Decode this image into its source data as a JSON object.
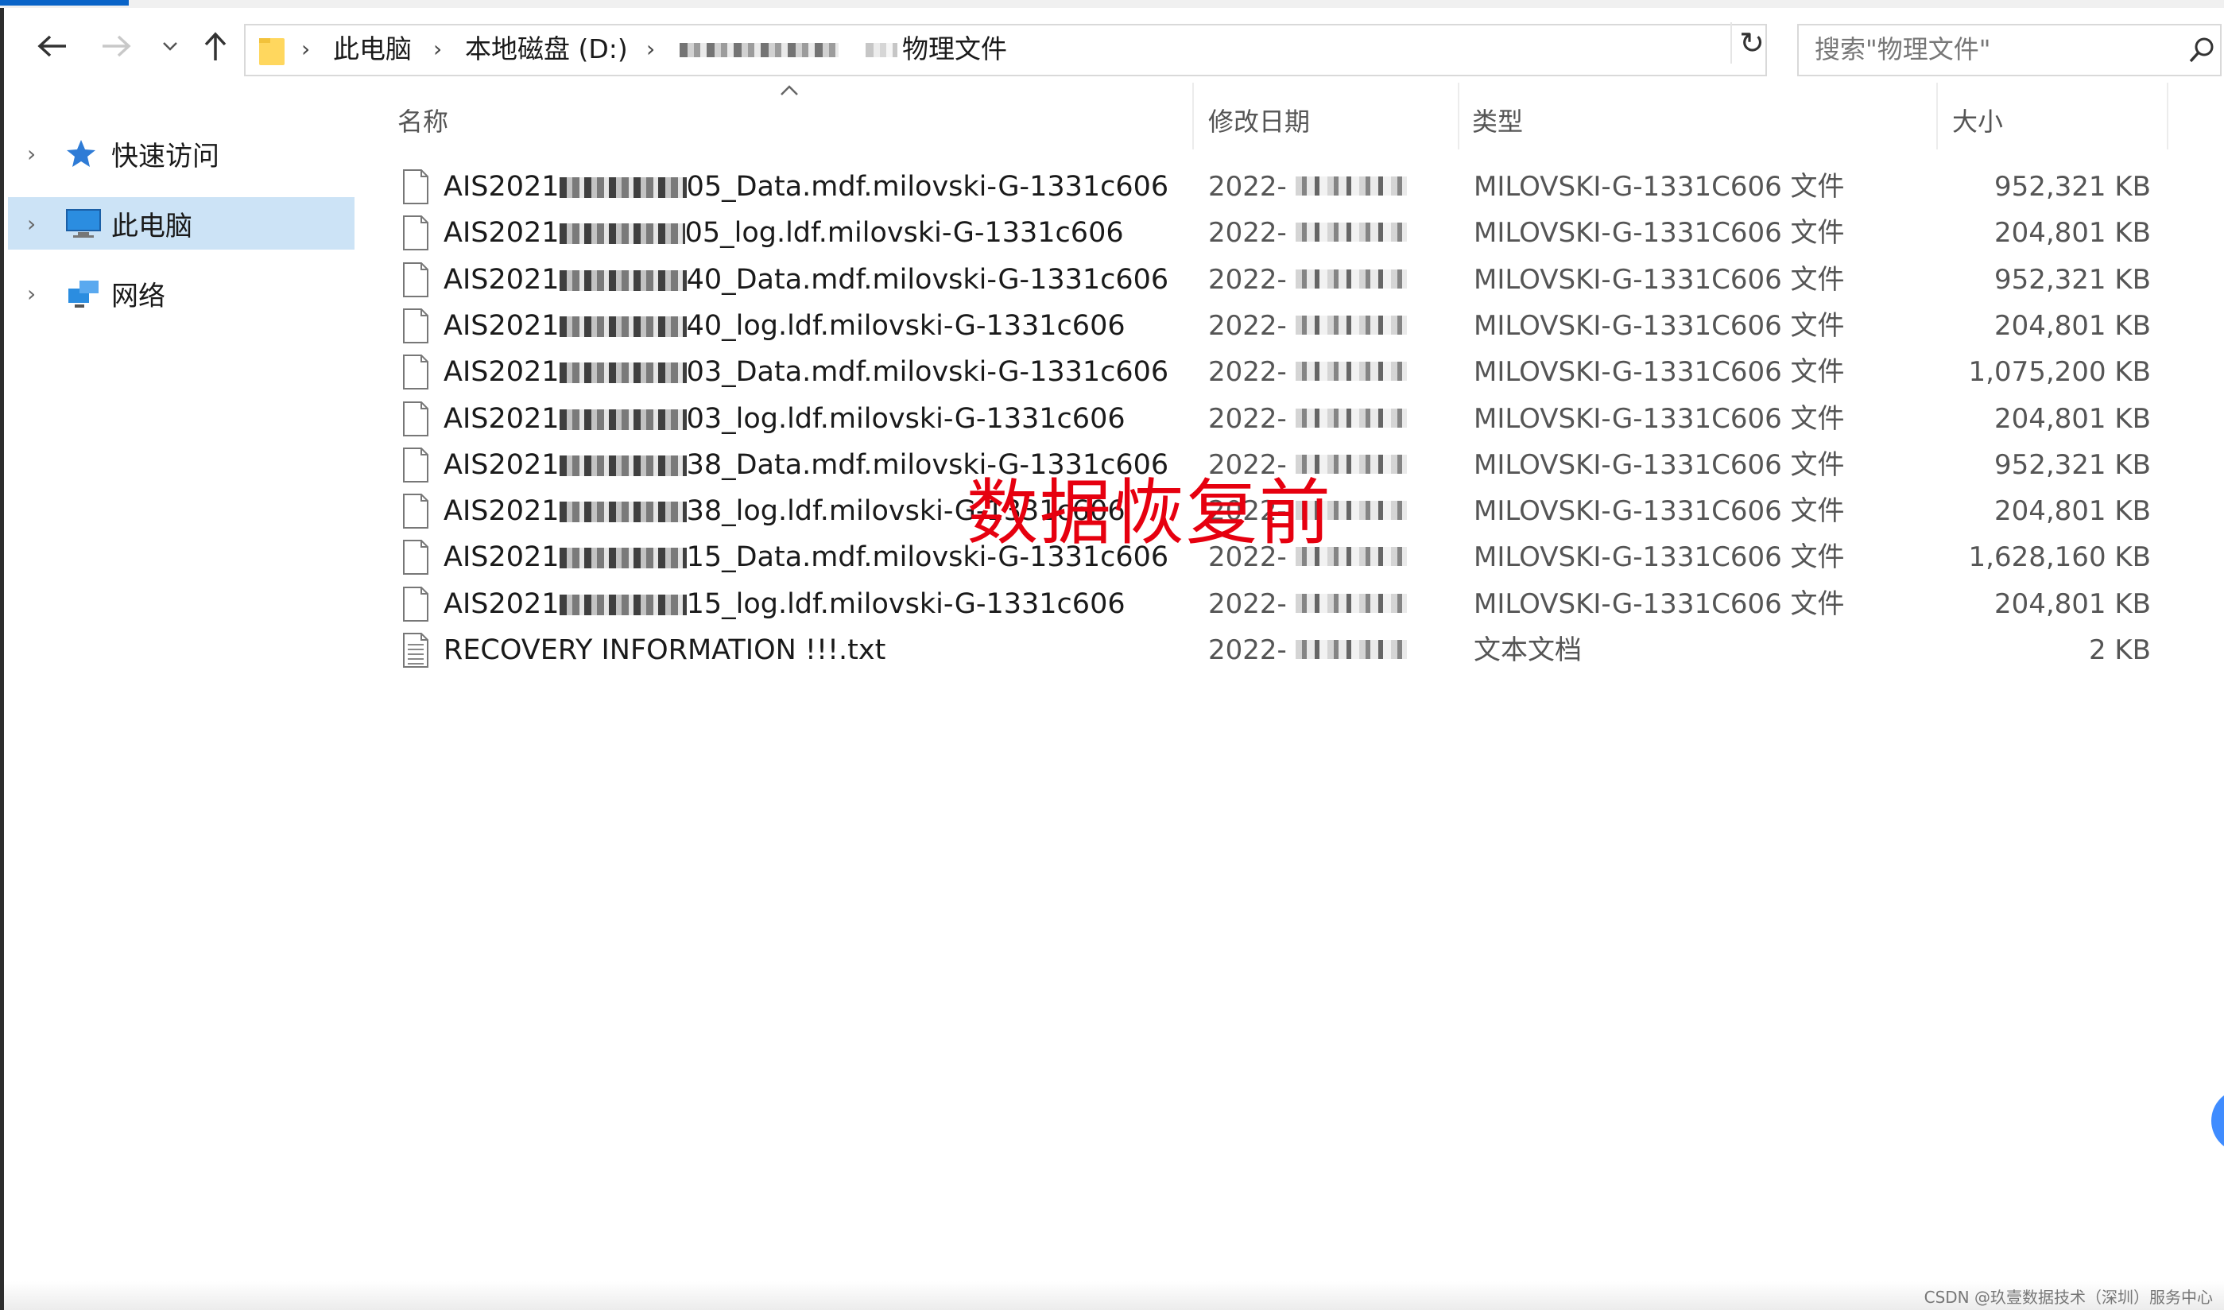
{
  "window": {
    "title_hidden": true
  },
  "address_bar": {
    "breadcrumbs": [
      "此电脑",
      "本地磁盘 (D:)",
      "物理文件"
    ]
  },
  "search": {
    "placeholder": "搜索\"物理文件\""
  },
  "nav_pane": {
    "items": [
      {
        "label": "快速访问",
        "icon": "star-icon",
        "selected": false
      },
      {
        "label": "此电脑",
        "icon": "computer-icon",
        "selected": true
      },
      {
        "label": "网络",
        "icon": "network-icon",
        "selected": false
      }
    ]
  },
  "columns": {
    "name": "名称",
    "date": "修改日期",
    "type": "类型",
    "size": "大小"
  },
  "files": [
    {
      "prefix": "AIS2021",
      "suffix": "05_Data.mdf.milovski-G-1331c606",
      "date": "2022-",
      "type": "MILOVSKI-G-1331C606 文件",
      "size": "952,321 KB"
    },
    {
      "prefix": "AIS2021",
      "suffix": "05_log.ldf.milovski-G-1331c606",
      "date": "2022-",
      "type": "MILOVSKI-G-1331C606 文件",
      "size": "204,801 KB"
    },
    {
      "prefix": "AIS2021",
      "suffix": "40_Data.mdf.milovski-G-1331c606",
      "date": "2022-",
      "type": "MILOVSKI-G-1331C606 文件",
      "size": "952,321 KB"
    },
    {
      "prefix": "AIS2021",
      "suffix": "40_log.ldf.milovski-G-1331c606",
      "date": "2022-",
      "type": "MILOVSKI-G-1331C606 文件",
      "size": "204,801 KB"
    },
    {
      "prefix": "AIS2021",
      "suffix": "03_Data.mdf.milovski-G-1331c606",
      "date": "2022-",
      "type": "MILOVSKI-G-1331C606 文件",
      "size": "1,075,200 KB"
    },
    {
      "prefix": "AIS2021",
      "suffix": "03_log.ldf.milovski-G-1331c606",
      "date": "2022-",
      "type": "MILOVSKI-G-1331C606 文件",
      "size": "204,801 KB"
    },
    {
      "prefix": "AIS2021",
      "suffix": "38_Data.mdf.milovski-G-1331c606",
      "date": "2022-",
      "type": "MILOVSKI-G-1331C606 文件",
      "size": "952,321 KB"
    },
    {
      "prefix": "AIS2021",
      "suffix": "38_log.ldf.milovski-G-1331c606",
      "date": "2022-",
      "type": "MILOVSKI-G-1331C606 文件",
      "size": "204,801 KB"
    },
    {
      "prefix": "AIS2021",
      "suffix": "15_Data.mdf.milovski-G-1331c606",
      "date": "2022-",
      "type": "MILOVSKI-G-1331C606 文件",
      "size": "1,628,160 KB"
    },
    {
      "prefix": "AIS2021",
      "suffix": "15_log.ldf.milovski-G-1331c606",
      "date": "2022-",
      "type": "MILOVSKI-G-1331C606 文件",
      "size": "204,801 KB"
    },
    {
      "prefix": "",
      "suffix": "RECOVERY INFORMATION !!!.txt",
      "date": "2022-",
      "type": "文本文档",
      "size": "2 KB"
    }
  ],
  "overlay_text": "数据恢复前",
  "watermark": "CSDN @玖壹数据技术（深圳）服务中心",
  "colors": {
    "selection": "#cce3f6",
    "overlay": "#e6000f",
    "accent": "#0a64c8"
  }
}
